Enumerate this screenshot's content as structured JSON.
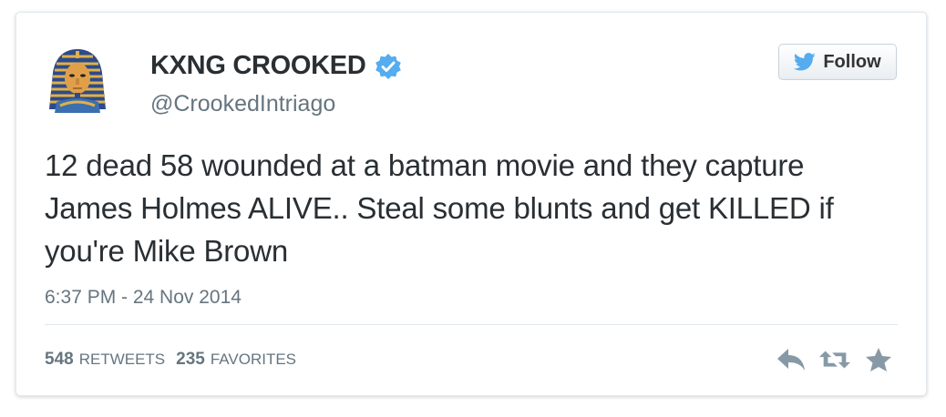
{
  "user": {
    "display_name": "KXNG CROOKED",
    "handle": "@CrookedIntriago",
    "verified": true,
    "avatar_icon": "pharaoh-mask-icon"
  },
  "follow_button": {
    "label": "Follow",
    "icon": "twitter-bird-icon"
  },
  "tweet": {
    "text": "12 dead 58 wounded at a batman movie and they capture James Holmes ALIVE.. Steal some blunts and get KILLED if you're Mike Brown",
    "timestamp": "6:37 PM - 24 Nov 2014"
  },
  "stats": {
    "retweets_count": "548",
    "retweets_label": "RETWEETS",
    "favorites_count": "235",
    "favorites_label": "FAVORITES"
  },
  "actions": [
    {
      "name": "reply-icon"
    },
    {
      "name": "retweet-icon"
    },
    {
      "name": "favorite-star-icon"
    }
  ],
  "colors": {
    "text": "#292f33",
    "muted": "#66757f",
    "verified_blue": "#55acee",
    "action_gray": "#8899a6"
  }
}
